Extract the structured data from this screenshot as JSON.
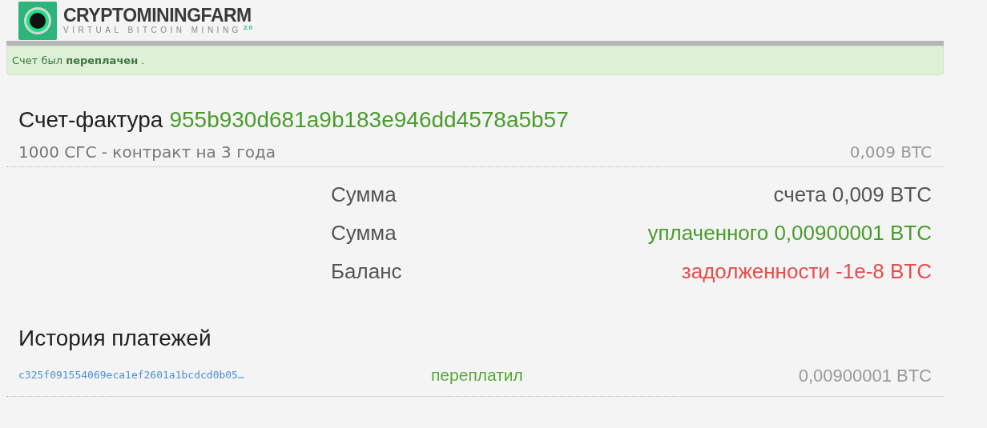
{
  "logo": {
    "name": "CRYPTOMININGFARM",
    "tagline": "VIRTUAL BITCOIN MINING",
    "version": "2.0"
  },
  "alert": {
    "message": "Счет был **переплачен** ."
  },
  "invoice": {
    "label": "Счет-фактура",
    "id": "955b930d681a9b183e946dd4578a5b57",
    "description": "1000 СГС - контракт на 3 года",
    "price": "0,009 BTC"
  },
  "summary": [
    {
      "label": "Сумма",
      "value": "счета 0,009 BTC",
      "kind": "total"
    },
    {
      "label": "Сумма",
      "value": "уплаченного 0,00900001 BTC",
      "kind": "paid"
    },
    {
      "label": "Баланс",
      "value": "задолженности -1e-8 BTC",
      "kind": "debt"
    }
  ],
  "payment_history": {
    "title": "История платежей",
    "payments": [
      {
        "transaction": "c325f091554069eca1ef2601a1bcdcd0b05…",
        "status": "переплатил",
        "amount": "0,00900001 BTC"
      }
    ]
  }
}
